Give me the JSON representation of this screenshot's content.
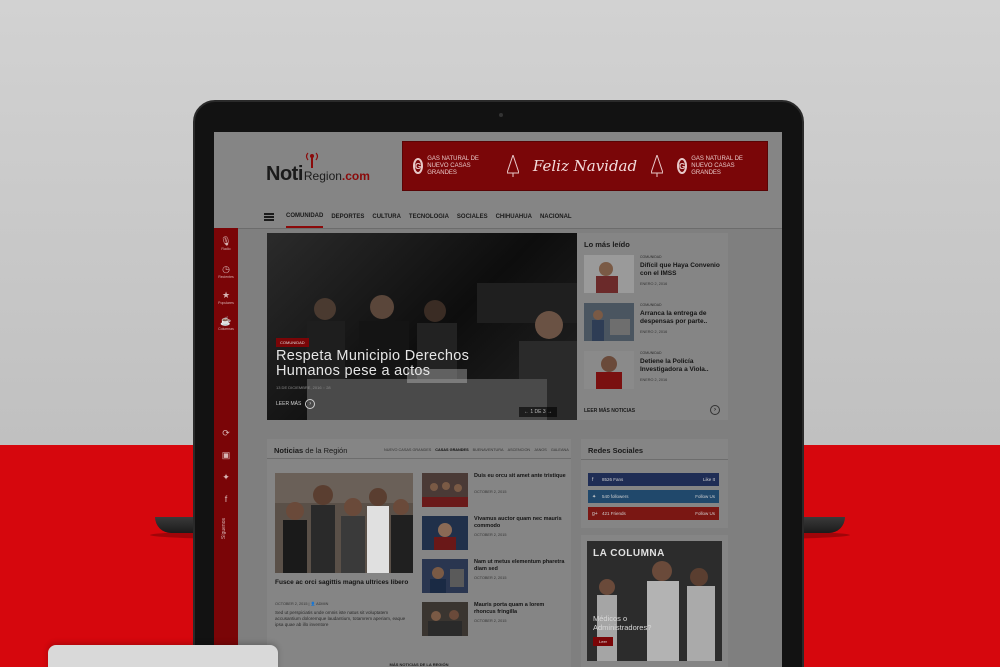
{
  "site": {
    "logo": {
      "noti": "Noti",
      "region": "Region",
      "com": ".com"
    }
  },
  "banner": {
    "brand_mark": "G",
    "brand_text": "GAS NATURAL DE NUEVO CASAS GRANDES",
    "greeting": "Feliz Navidad"
  },
  "nav": {
    "items": [
      "COMUNIDAD",
      "DEPORTES",
      "CULTURA",
      "TECNOLOGIA",
      "SOCIALES",
      "CHIHUAHUA",
      "NACIONAL"
    ]
  },
  "rail": {
    "items": [
      {
        "icon": "microphone-icon",
        "glyph": "🎙",
        "label": "Radio"
      },
      {
        "icon": "clock-icon",
        "glyph": "◷",
        "label": "Recientes"
      },
      {
        "icon": "star-icon",
        "glyph": "★",
        "label": "Populares"
      },
      {
        "icon": "coffee-icon",
        "glyph": "☕",
        "label": "Columnas"
      }
    ],
    "social": [
      {
        "icon": "rss-icon",
        "glyph": "⟳"
      },
      {
        "icon": "instagram-icon",
        "glyph": "▣"
      },
      {
        "icon": "twitter-icon",
        "glyph": "✦"
      },
      {
        "icon": "facebook-icon",
        "glyph": "f"
      }
    ],
    "follow_label": "Síguenos"
  },
  "hero": {
    "tag": "COMUNIDAD",
    "title": "Respeta Municipio Derechos Humanos pese a actos",
    "meta": "13 DE DICIEMBRE, 2016",
    "comments": "28",
    "read_more": "LEER MÁS",
    "pager": "1 DE 3"
  },
  "most_read": {
    "title": "Lo más leído",
    "items": [
      {
        "category": "COMUNIDAD",
        "headline": "Difícil que Haya Convenio con el IMSS",
        "date": "ENERO 2, 2016"
      },
      {
        "category": "COMUNIDAD",
        "headline": "Arranca la entrega de despensas por parte..",
        "date": "ENERO 2, 2016"
      },
      {
        "category": "COMUNIDAD",
        "headline": "Detiene la Policía Investigadora a Viola..",
        "date": "ENERO 2, 2016"
      }
    ],
    "more": "LEER MÁS NOTICIAS"
  },
  "news": {
    "title_prefix": "Noticias",
    "title_suffix": " de la Región",
    "tabs": [
      "NUEVO CASAS GRANDES",
      "CASAS GRANDES",
      "BUENAVENTURA",
      "ASCENCION",
      "JANOS",
      "GALEANA"
    ],
    "active_tab": 1,
    "featured": {
      "title": "Fusce ac orci sagittis magna ultrices libero",
      "date": "OCTOBER 2, 2015",
      "author": "ADMIN",
      "body": "Sed ut perspiciatis unde omnis iste natus sit voluptatem accusantium doloremque laudantium, totamrem aperiam, eaque ipsa quae ab illo inventore"
    },
    "side": [
      {
        "title": "Duis eu orcu sit amet ante tristique",
        "date": "OCTOBER 2, 2015"
      },
      {
        "title": "Vivamus auctor quam nec mauris commodo",
        "date": "OCTOBER 2, 2015"
      },
      {
        "title": "Nam ut metus elementum pharetra diam sed",
        "date": "OCTOBER 2, 2015"
      },
      {
        "title": "Mauris porta quam a lorem rhoncus fringilla",
        "date": "OCTOBER 2, 2015"
      }
    ],
    "more": "MÁS NOTICIAS DE LA REGIÓN"
  },
  "social": {
    "title": "Redes Sociales",
    "rows": [
      {
        "network": "facebook",
        "glyph": "f",
        "count": "8526 Fans",
        "action": "Like It"
      },
      {
        "network": "twitter",
        "glyph": "✦",
        "count": "540 followers",
        "action": "Follow Us"
      },
      {
        "network": "google-plus",
        "glyph": "g+",
        "count": "421 Friends",
        "action": "Follow Us"
      }
    ]
  },
  "columna": {
    "title": "LA COLUMNA",
    "question": "Médicos o Administradores?",
    "button": "Leer"
  },
  "colors": {
    "brand_red": "#d6070d",
    "dark_red": "#7a0507"
  }
}
